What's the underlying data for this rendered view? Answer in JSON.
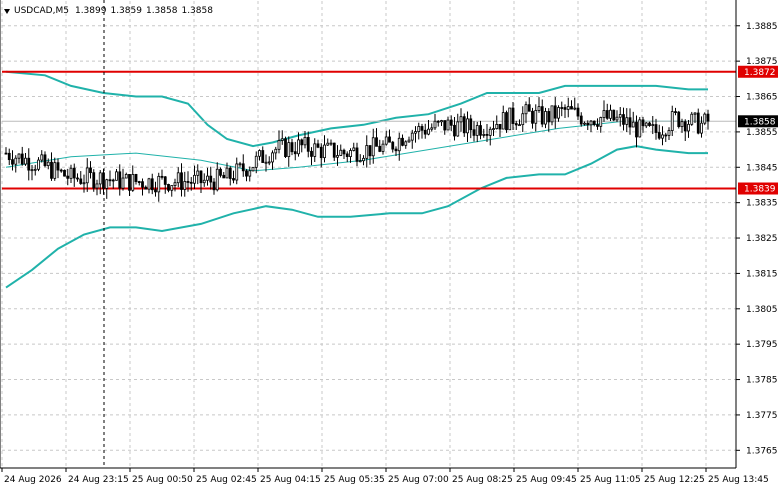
{
  "chart_header": {
    "symbol": "USDCAD,M5",
    "quotes": [
      "1.3899",
      "1.3859",
      "1.3858",
      "1.3858"
    ]
  },
  "price_axis": {
    "labels": [
      "1.3885",
      "1.3875",
      "1.3865",
      "1.3855",
      "1.3845",
      "1.3835",
      "1.3825",
      "1.3815",
      "1.3805",
      "1.3795",
      "1.3785",
      "1.3775",
      "1.3765"
    ]
  },
  "time_axis": {
    "labels": [
      "24 Aug 2026",
      "24 Aug 23:15",
      "25 Aug 00:50",
      "25 Aug 02:45",
      "25 Aug 04:15",
      "25 Aug 05:35",
      "25 Aug 07:00",
      "25 Aug 08:25",
      "25 Aug 09:45",
      "25 Aug 11:05",
      "25 Aug 12:25",
      "25 Aug 13:45"
    ]
  },
  "levels": [
    {
      "label": "1.3872",
      "price": 1.3872,
      "color": "#e00000"
    },
    {
      "label": "1.3839",
      "price": 1.3839,
      "color": "#e00000"
    }
  ],
  "current_price": {
    "label": "1.3858",
    "price": 1.3858
  },
  "colors": {
    "bands": "#20b2aa",
    "candles": "#000000",
    "level_line": "#e00000",
    "grid": "#c8c8c8",
    "background": "#ffffff"
  },
  "chart_data": {
    "type": "candlestick",
    "ylim": [
      1.376,
      1.3892
    ],
    "bollinger_upper": [
      [
        0,
        1.3872
      ],
      [
        12,
        1.3871
      ],
      [
        20,
        1.3868
      ],
      [
        30,
        1.3866
      ],
      [
        40,
        1.3865
      ],
      [
        48,
        1.3865
      ],
      [
        56,
        1.3863
      ],
      [
        62,
        1.3857
      ],
      [
        68,
        1.3853
      ],
      [
        76,
        1.3851
      ],
      [
        82,
        1.3852
      ],
      [
        90,
        1.3854
      ],
      [
        100,
        1.3856
      ],
      [
        110,
        1.3857
      ],
      [
        120,
        1.3859
      ],
      [
        130,
        1.386
      ],
      [
        140,
        1.3863
      ],
      [
        148,
        1.3866
      ],
      [
        156,
        1.3866
      ],
      [
        164,
        1.3866
      ],
      [
        172,
        1.3868
      ],
      [
        180,
        1.3868
      ],
      [
        190,
        1.3868
      ],
      [
        200,
        1.3868
      ],
      [
        210,
        1.3867
      ],
      [
        216,
        1.3867
      ]
    ],
    "bollinger_middle": [
      [
        0,
        1.3845
      ],
      [
        20,
        1.3848
      ],
      [
        40,
        1.3849
      ],
      [
        60,
        1.3847
      ],
      [
        76,
        1.3844
      ],
      [
        90,
        1.3845
      ],
      [
        110,
        1.3847
      ],
      [
        130,
        1.385
      ],
      [
        150,
        1.3853
      ],
      [
        170,
        1.3856
      ],
      [
        190,
        1.3858
      ],
      [
        216,
        1.3858
      ]
    ],
    "bollinger_lower": [
      [
        0,
        1.3811
      ],
      [
        8,
        1.3816
      ],
      [
        16,
        1.3822
      ],
      [
        24,
        1.3826
      ],
      [
        32,
        1.3828
      ],
      [
        40,
        1.3828
      ],
      [
        48,
        1.3827
      ],
      [
        60,
        1.3829
      ],
      [
        70,
        1.3832
      ],
      [
        80,
        1.3834
      ],
      [
        88,
        1.3833
      ],
      [
        96,
        1.3831
      ],
      [
        106,
        1.3831
      ],
      [
        118,
        1.3832
      ],
      [
        128,
        1.3832
      ],
      [
        136,
        1.3834
      ],
      [
        146,
        1.3839
      ],
      [
        154,
        1.3842
      ],
      [
        164,
        1.3843
      ],
      [
        172,
        1.3843
      ],
      [
        180,
        1.3846
      ],
      [
        188,
        1.385
      ],
      [
        194,
        1.3851
      ],
      [
        200,
        1.385
      ],
      [
        210,
        1.3849
      ],
      [
        216,
        1.3849
      ]
    ],
    "candle_anchors": [
      [
        0,
        1.3849
      ],
      [
        10,
        1.3846
      ],
      [
        20,
        1.3842
      ],
      [
        30,
        1.3842
      ],
      [
        36,
        1.3841
      ],
      [
        40,
        1.3841
      ],
      [
        46,
        1.3841
      ],
      [
        52,
        1.3841
      ],
      [
        56,
        1.3841
      ],
      [
        62,
        1.3841
      ],
      [
        68,
        1.3842
      ],
      [
        76,
        1.3846
      ],
      [
        82,
        1.385
      ],
      [
        90,
        1.3851
      ],
      [
        96,
        1.385
      ],
      [
        104,
        1.3849
      ],
      [
        110,
        1.385
      ],
      [
        118,
        1.3851
      ],
      [
        124,
        1.3855
      ],
      [
        130,
        1.3856
      ],
      [
        136,
        1.3857
      ],
      [
        144,
        1.3856
      ],
      [
        152,
        1.3858
      ],
      [
        160,
        1.386
      ],
      [
        166,
        1.3859
      ],
      [
        172,
        1.3861
      ],
      [
        178,
        1.3859
      ],
      [
        184,
        1.3859
      ],
      [
        190,
        1.3858
      ],
      [
        196,
        1.3855
      ],
      [
        200,
        1.3855
      ],
      [
        206,
        1.3859
      ],
      [
        210,
        1.3858
      ],
      [
        214,
        1.3857
      ],
      [
        216,
        1.3858
      ]
    ],
    "x_count": 217
  }
}
